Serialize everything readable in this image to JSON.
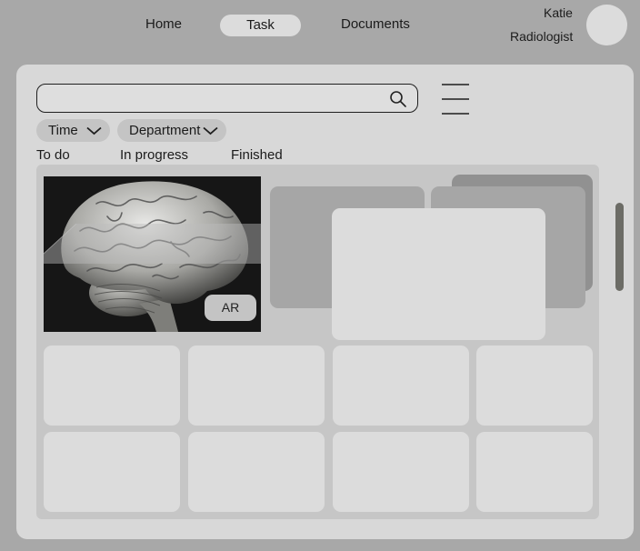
{
  "nav": {
    "home": "Home",
    "task": "Task",
    "documents": "Documents"
  },
  "user": {
    "name": "Katie",
    "role": "Radiologist"
  },
  "search": {
    "value": "",
    "placeholder": ""
  },
  "filters": {
    "time": "Time",
    "department": "Department"
  },
  "status_tabs": {
    "todo": "To do",
    "in_progress": "In progress",
    "finished": "Finished"
  },
  "case_card": {
    "badge": "AR"
  },
  "colors": {
    "background": "#a8a8a8",
    "panel": "#d8d8d8",
    "card": "#dcdcdc",
    "scrollbar": "#6c6c66"
  }
}
